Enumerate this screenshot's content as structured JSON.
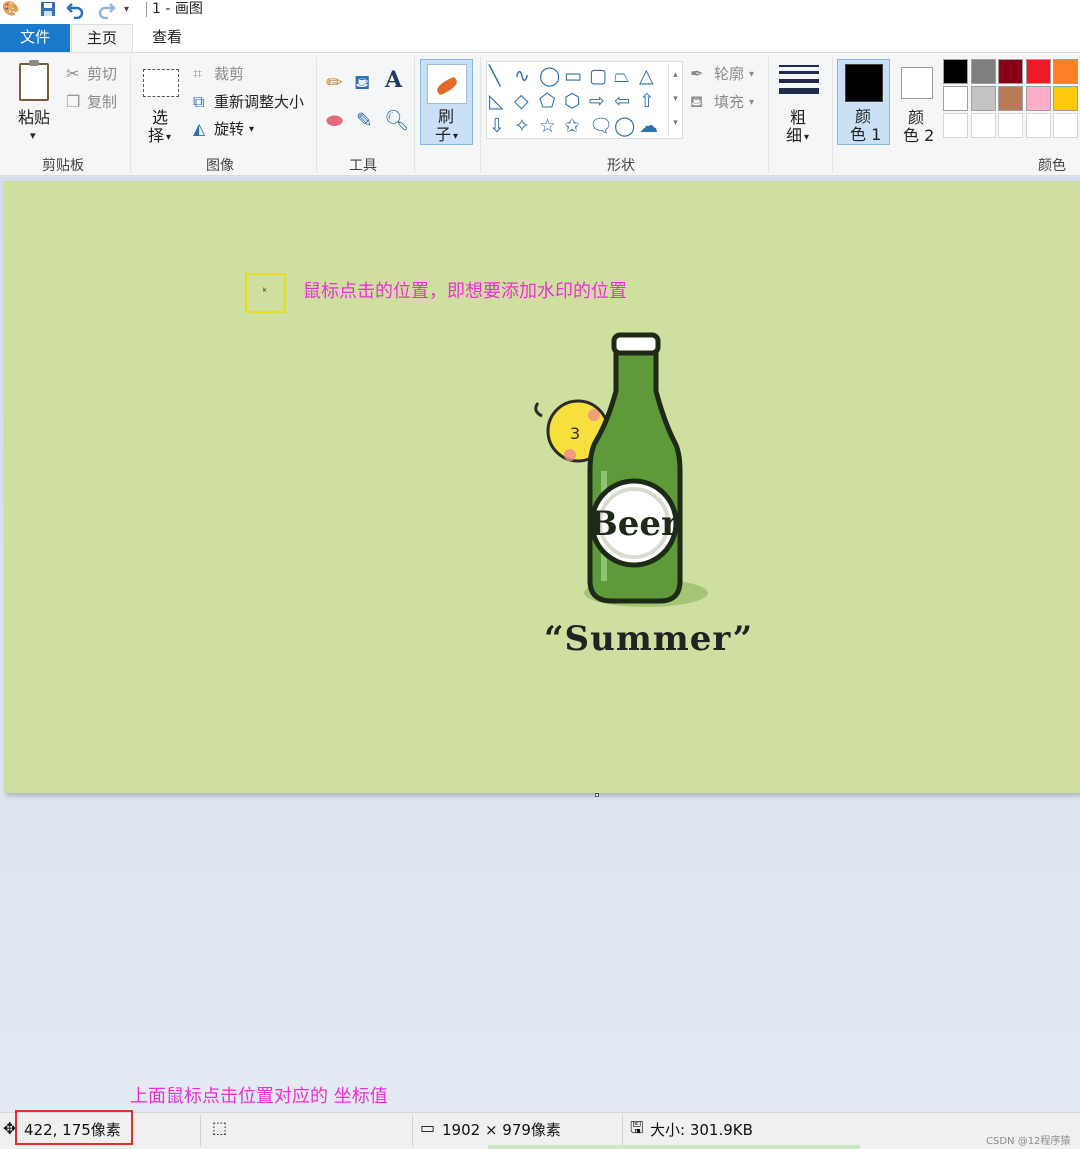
{
  "window": {
    "title": "1 - 画图",
    "quick_access_icons": [
      "paint-app-icon",
      "save-icon",
      "undo-icon",
      "redo-icon",
      "customize-dropdown-icon"
    ]
  },
  "tabs": [
    {
      "label": "文件",
      "active": false
    },
    {
      "label": "主页",
      "active": true
    },
    {
      "label": "查看",
      "active": false
    }
  ],
  "ribbon": {
    "clipboard": {
      "paste_label_line1": "粘贴",
      "paste_arrow": "▾",
      "cut_label": "剪切",
      "copy_label": "复制",
      "group_label": "剪贴板"
    },
    "image": {
      "select_label_line1": "选",
      "select_label_line2": "择",
      "crop_label": "裁剪",
      "resize_label": "重新调整大小",
      "rotate_label": "旋转",
      "group_label": "图像"
    },
    "tools": {
      "group_label": "工具",
      "icons": [
        "pencil-icon",
        "fill-bucket-icon",
        "text-icon",
        "eraser-icon",
        "color-picker-icon",
        "magnifier-icon"
      ],
      "text_tool_glyph": "A"
    },
    "brushes": {
      "label_line1": "刷",
      "label_line2": "子"
    },
    "shapes": {
      "group_label": "形状",
      "outline_label": "轮廓",
      "fill_label": "填充",
      "glyphs_row1": [
        "╲",
        "∿",
        "◯",
        "▭",
        "▢",
        "⏢",
        "△"
      ],
      "glyphs_row2": [
        "◺",
        "◇",
        "⬠",
        "⬡",
        "⇨",
        "⇦",
        "⇧"
      ],
      "glyphs_row3": [
        "⇩",
        "✧",
        "☆",
        "✩",
        "🗨",
        "◯",
        "☁"
      ]
    },
    "size": {
      "label_line1": "粗",
      "label_line2": "细"
    },
    "colors": {
      "color1_line1": "颜",
      "color1_line2": "色 1",
      "color2_line1": "颜",
      "color2_line2": "色 2",
      "group_label": "颜色",
      "color1_value": "#000000",
      "color2_value": "#ffffff",
      "palette_row1": [
        "#000000",
        "#7f7f7f",
        "#880015",
        "#ed1c24",
        "#ff7f27"
      ],
      "palette_row2": [
        "#ffffff",
        "#c3c3c3",
        "#b97a57",
        "#ffaec9",
        "#ffc90e"
      ]
    }
  },
  "canvas": {
    "background": "#cfdfa0",
    "annotation_click": "鼠标点击的位置，即想要添加水印的位置",
    "bottle_label": "Beer",
    "caption": "“Summer”"
  },
  "annotation_bottom": "上面鼠标点击位置对应的 坐标值",
  "status": {
    "cursor_position": "422, 175像素",
    "image_size": "1902 × 979像素",
    "file_size": "大小: 301.9KB"
  },
  "watermark": "CSDN @12程序猿"
}
